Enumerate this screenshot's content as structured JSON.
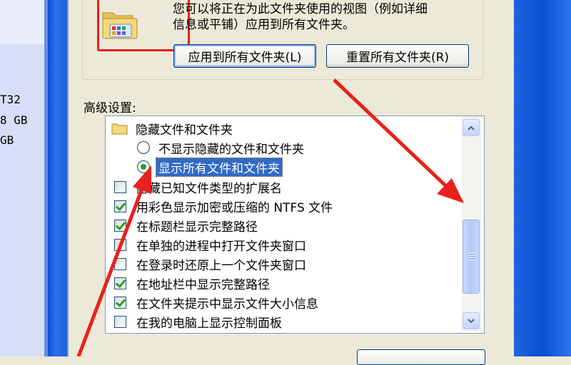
{
  "left_panel": {
    "filesystem": "T32",
    "size_1": "8 GB",
    "size_2": "GB"
  },
  "folder_views": {
    "icon": "folder-views-icon",
    "description_line1": "您可以将正在为此文件夹使用的视图（例如详细",
    "description_line2": "信息或平铺）应用到所有文件夹。",
    "apply_button": "应用到所有文件夹(L)",
    "reset_button": "重置所有文件夹(R)"
  },
  "advanced": {
    "label": "高级设置:",
    "items": [
      {
        "type": "folder",
        "label": "隐藏文件和文件夹",
        "icon": "folder-icon"
      },
      {
        "type": "radio",
        "checked": false,
        "label": "不显示隐藏的文件和文件夹"
      },
      {
        "type": "radio",
        "checked": true,
        "label": "显示所有文件和文件夹",
        "selected": true
      },
      {
        "type": "checkbox",
        "checked": false,
        "label": "隐藏已知文件类型的扩展名"
      },
      {
        "type": "checkbox",
        "checked": true,
        "label": "用彩色显示加密或压缩的 NTFS 文件"
      },
      {
        "type": "checkbox",
        "checked": true,
        "label": "在标题栏显示完整路径"
      },
      {
        "type": "checkbox",
        "checked": false,
        "label": "在单独的进程中打开文件夹窗口"
      },
      {
        "type": "checkbox",
        "checked": false,
        "label": "在登录时还原上一个文件夹窗口"
      },
      {
        "type": "checkbox",
        "checked": true,
        "label": "在地址栏中显示完整路径"
      },
      {
        "type": "checkbox",
        "checked": true,
        "label": "在文件夹提示中显示文件大小信息"
      },
      {
        "type": "checkbox",
        "checked": false,
        "label": "在我的电脑上显示控制面板"
      }
    ]
  },
  "scrollbar": {
    "up_icon": "scroll-up-arrow-icon",
    "down_icon": "scroll-down-arrow-icon",
    "position": 0.72
  },
  "annotation_color": "#e8211c"
}
